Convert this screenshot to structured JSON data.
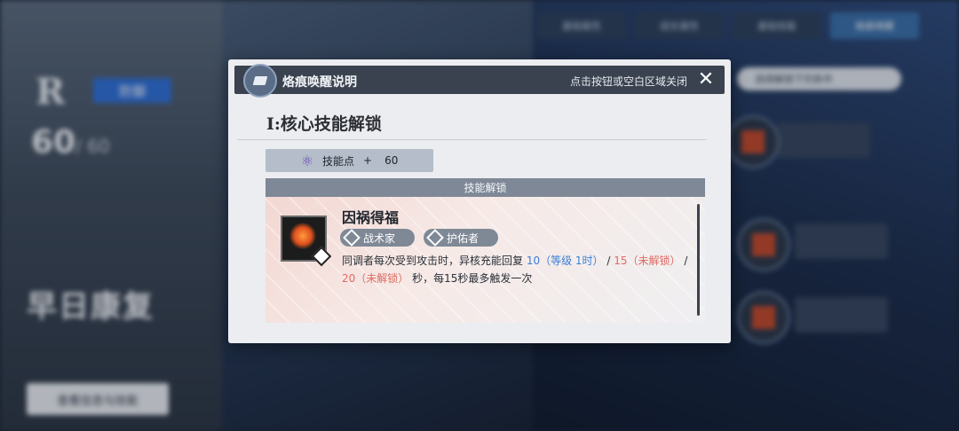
{
  "background": {
    "tabs": [
      "基础属性",
      "成长属性",
      "基础技能",
      "烙痕唤醒"
    ],
    "rank": "R",
    "role": "防御",
    "level": "60",
    "level_max": "/ 60",
    "character_name": "早日康复",
    "button": "查看信息与技能",
    "search_hint": "选择解锁下列条件"
  },
  "dialog": {
    "title": "烙痕唤醒说明",
    "close_hint": "点击按钮或空白区域关闭",
    "section_title": "I:核心技能解锁",
    "skill_point_label": "技能点",
    "skill_point_plus": "+",
    "skill_point_value": "60",
    "unlock_header": "技能解锁",
    "skill": {
      "name": "因祸得福",
      "tags": [
        "战术家",
        "护佑者"
      ],
      "desc_prefix": "同调者每次受到攻击时，异核充能回复 ",
      "value1": "10（等级 1时）",
      "sep1": " / ",
      "value2": "15（未解锁）",
      "sep2": " / ",
      "value3": "20（未解锁）",
      "desc_suffix": " 秒，每15秒最多触发一次"
    }
  }
}
